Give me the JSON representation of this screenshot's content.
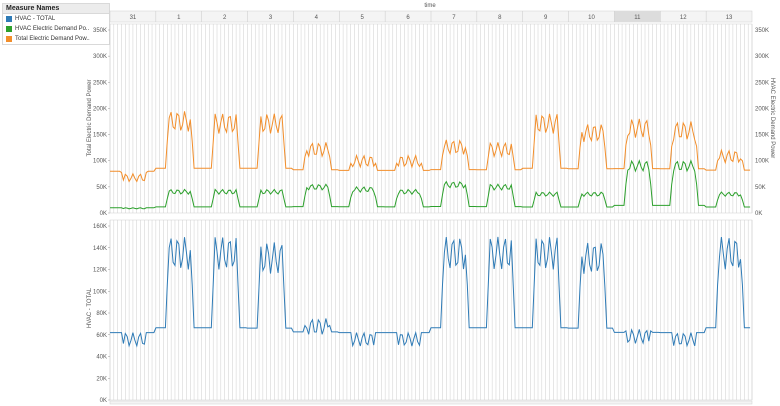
{
  "legend": {
    "title": "Measure Names",
    "items": [
      {
        "label": "HVAC - TOTAL",
        "color": "#2f7bb6"
      },
      {
        "label": "HVAC Electric Demand Po..",
        "color": "#2ca02c"
      },
      {
        "label": "Total Electric Demand Pow..",
        "color": "#f28e2b"
      }
    ]
  },
  "header": {
    "time_label": "time",
    "days": [
      "31",
      "1",
      "2",
      "3",
      "4",
      "5",
      "6",
      "7",
      "8",
      "9",
      "10",
      "11",
      "12",
      "13"
    ],
    "highlighted_day": "11"
  },
  "colors": {
    "hvac_total": "#2f7bb6",
    "hvac_demand": "#2ca02c",
    "total_demand": "#f28e2b",
    "grid": "#c8c8c8"
  },
  "chart_data": [
    {
      "type": "line",
      "ylabel": "Total Electric Demand Power",
      "ylabel_right": "HVAC Electric Demand Power",
      "ylim": [
        0,
        350000
      ],
      "yticks": [
        "0K",
        "50K",
        "100K",
        "150K",
        "200K",
        "250K",
        "300K",
        "350K"
      ],
      "yticks_right": [
        "0K",
        "50K",
        "100K",
        "150K",
        "200K",
        "250K",
        "300K",
        "350K"
      ],
      "x": [
        "31",
        "1",
        "2",
        "3",
        "4",
        "5",
        "6",
        "7",
        "8",
        "9",
        "10",
        "11",
        "12",
        "13"
      ],
      "series": [
        {
          "name": "Total Electric Demand Pow..",
          "values": [
            75000,
            195000,
            190000,
            190000,
            135000,
            110000,
            110000,
            140000,
            135000,
            190000,
            170000,
            180000,
            175000,
            120000
          ]
        },
        {
          "name": "HVAC Electric Demand Po..",
          "values": [
            10000,
            45000,
            45000,
            45000,
            55000,
            50000,
            45000,
            60000,
            55000,
            40000,
            40000,
            100000,
            100000,
            40000
          ]
        }
      ]
    },
    {
      "type": "line",
      "ylabel": "HVAC - TOTAL",
      "ylim": [
        0,
        160000
      ],
      "yticks": [
        "0K",
        "20K",
        "40K",
        "60K",
        "80K",
        "100K",
        "120K",
        "140K",
        "160K"
      ],
      "x": [
        "31",
        "1",
        "2",
        "3",
        "4",
        "5",
        "6",
        "7",
        "8",
        "9",
        "10",
        "11",
        "12",
        "13"
      ],
      "series": [
        {
          "name": "HVAC - TOTAL",
          "values": [
            62000,
            150000,
            150000,
            145000,
            75000,
            62000,
            62000,
            150000,
            150000,
            150000,
            145000,
            65000,
            62000,
            150000
          ]
        }
      ]
    }
  ]
}
